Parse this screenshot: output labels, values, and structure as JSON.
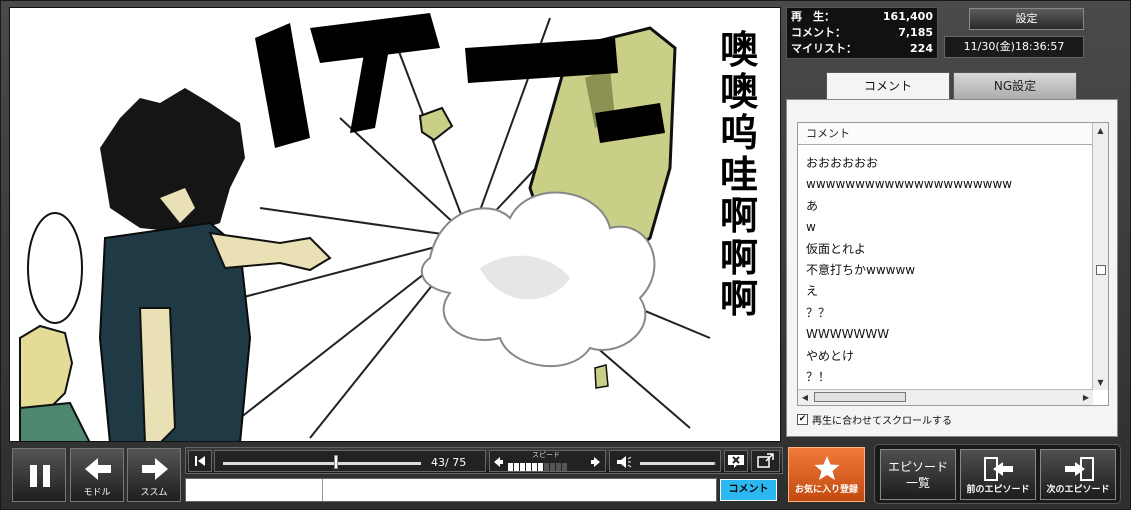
{
  "stats": {
    "views_label": "再　生：",
    "views_value": "161,400",
    "comments_label": "コメント：",
    "comments_value": "7,185",
    "mylist_label": "マイリスト：",
    "mylist_value": "224"
  },
  "header": {
    "settings_label": "設定",
    "datetime": "11/30(金)18:36:57"
  },
  "tabs": [
    {
      "label": "コメント",
      "active": true
    },
    {
      "label": "NG設定",
      "active": false
    }
  ],
  "comment_list": {
    "header": "コメント",
    "items": [
      "おおおおおお",
      "wwwwwwwwwwwwwwwwwwwww",
      "あ",
      "w",
      "仮面とれよ",
      "不意打ちかwwwww",
      "え",
      "？？",
      "WWWWWWW",
      "やめとけ",
      "？！"
    ],
    "autoscroll_label": "再生に合わせてスクロールする",
    "autoscroll_checked": true
  },
  "manga": {
    "sfx_top": "ドカーン",
    "sfx_vertical": [
      "噢",
      "噢",
      "呜",
      "哇",
      "啊",
      "啊",
      "啊"
    ]
  },
  "controls": {
    "pause_icon": "pause-icon",
    "back_label": "モドル",
    "forward_label": "ススム",
    "current_page": "43",
    "total_pages": "75",
    "page_progress": 0.573,
    "speed_label": "スピード",
    "speed_level": 6,
    "speed_max": 10,
    "volume_level": 0.98,
    "comment_submit": "コメント",
    "favorite_label": "お気に入り登録",
    "episode_list_label_1": "エピソード",
    "episode_list_label_2": "一覧",
    "prev_episode_label": "前のエピソード",
    "next_episode_label": "次のエピソード"
  },
  "colors": {
    "accent_favorite": "#e8641e",
    "comment_button": "#2bb8f0",
    "panel_bg": "#f4f4f4"
  }
}
